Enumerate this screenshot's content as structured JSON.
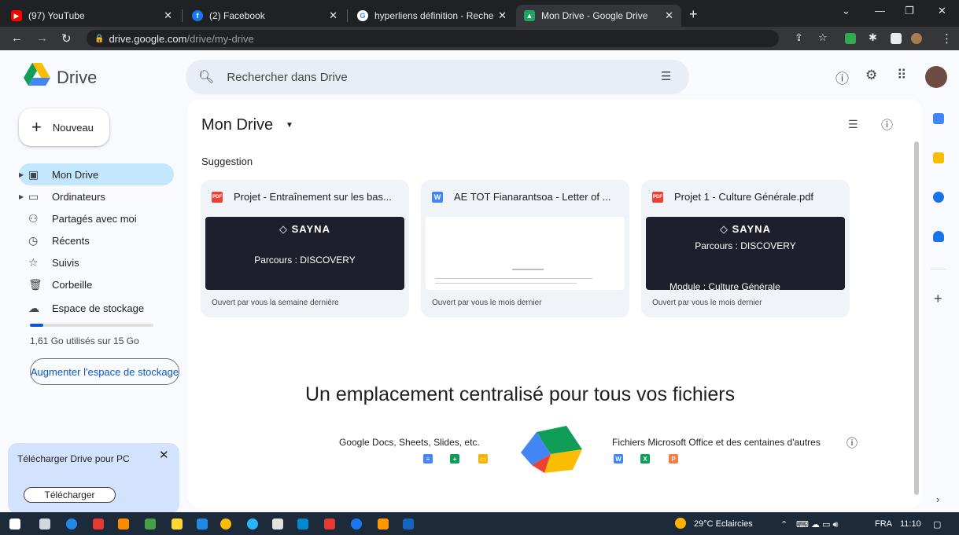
{
  "browser": {
    "tabs": [
      {
        "title": "(97) YouTube",
        "color": "#ff0000",
        "glyph": "▶"
      },
      {
        "title": "(2) Facebook",
        "color": "#1877f2",
        "glyph": "f"
      },
      {
        "title": "hyperliens définition - Recherche",
        "color": "#4285f4",
        "glyph": "G"
      },
      {
        "title": "Mon Drive - Google Drive",
        "color": "#1fa463",
        "glyph": "▲"
      }
    ],
    "url_host": "drive.google.com",
    "url_path": "/drive/my-drive"
  },
  "app": {
    "brand": "Drive",
    "search_placeholder": "Rechercher dans Drive"
  },
  "sidebar": {
    "new_label": "Nouveau",
    "items": [
      {
        "label": "Mon Drive",
        "icon": "drive-icon",
        "glyph": "▣",
        "expandable": true,
        "active": true
      },
      {
        "label": "Ordinateurs",
        "icon": "computer-icon",
        "glyph": "▭",
        "expandable": true,
        "active": false
      },
      {
        "label": "Partagés avec moi",
        "icon": "people-icon",
        "glyph": "👥",
        "expandable": false,
        "active": false
      },
      {
        "label": "Récents",
        "icon": "clock-icon",
        "glyph": "◷",
        "expandable": false,
        "active": false
      },
      {
        "label": "Suivis",
        "icon": "star-icon",
        "glyph": "☆",
        "expandable": false,
        "active": false
      },
      {
        "label": "Corbeille",
        "icon": "trash-icon",
        "glyph": "🗑",
        "expandable": false,
        "active": false
      },
      {
        "label": "Espace de stockage",
        "icon": "cloud-icon",
        "glyph": "☁",
        "expandable": false,
        "active": false
      }
    ],
    "storage_fraction": 0.107,
    "storage_text": "1,61 Go utilisés sur 15 Go",
    "upgrade_label": "Augmenter l'espace de stockage",
    "promo_text": "Télécharger Drive pour PC",
    "promo_button": "Télécharger"
  },
  "main": {
    "title": "Mon Drive",
    "suggestion_label": "Suggestion",
    "cards": [
      {
        "name": "Projet - Entraînement sur les bas...",
        "type": "PDF",
        "type_color": "#ea4335",
        "opened": "Ouvert par vous la semaine dernière",
        "thumb_brand": "◇ SAYNA",
        "thumb_line1": "Parcours : DISCOVERY",
        "thumb_line2": ""
      },
      {
        "name": "AE TOT Fianarantsoa - Letter of ...",
        "type": "W",
        "type_color": "#4285f4",
        "opened": "Ouvert par vous le mois dernier",
        "thumb_brand": "",
        "thumb_line1": "",
        "thumb_line2": ""
      },
      {
        "name": "Projet 1 - Culture Générale.pdf",
        "type": "PDF",
        "type_color": "#ea4335",
        "opened": "Ouvert par vous le mois dernier",
        "thumb_brand": "◇ SAYNA",
        "thumb_line1": "Parcours : DISCOVERY",
        "thumb_line2": "Module : Culture Générale"
      }
    ],
    "cta_title": "Un emplacement centralisé pour tous vos fichiers",
    "left_label": "Google Docs, Sheets, Slides, etc.",
    "right_label": "Fichiers Microsoft Office et des centaines d'autres",
    "google_apps": [
      {
        "icon": "docs-icon",
        "color": "#4285f4",
        "glyph": "≡"
      },
      {
        "icon": "sheets-icon",
        "color": "#0f9d58",
        "glyph": "+"
      },
      {
        "icon": "slides-icon",
        "color": "#f4b400",
        "glyph": "▭"
      }
    ],
    "office_apps": [
      {
        "icon": "word-icon",
        "color": "#4285f4",
        "glyph": "W"
      },
      {
        "icon": "excel-icon",
        "color": "#0f9d58",
        "glyph": "X"
      },
      {
        "icon": "powerpoint-icon",
        "color": "#f57c42",
        "glyph": "P"
      }
    ]
  },
  "taskbar": {
    "weather": "29°C  Eclaircies",
    "lang": "FRA",
    "time": "11:10"
  }
}
